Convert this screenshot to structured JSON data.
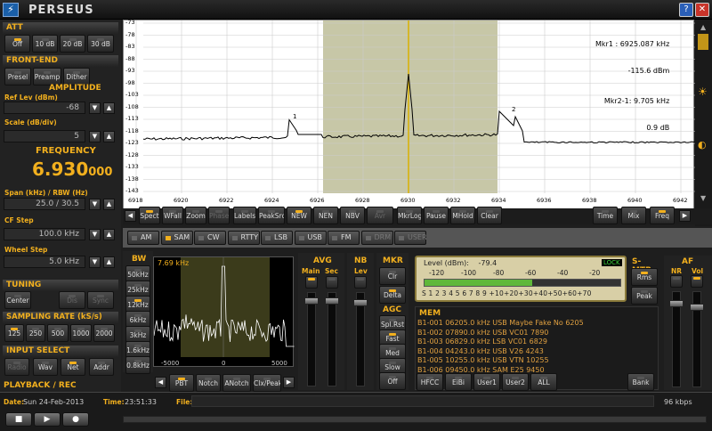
{
  "title": "PERSEUS",
  "att": {
    "title": "ATT",
    "buttons": [
      "Off",
      "10 dB",
      "20 dB",
      "30 dB"
    ]
  },
  "front_end": {
    "title": "FRONT-END",
    "buttons": [
      "Presel",
      "Preamp",
      "Dither"
    ]
  },
  "amplitude": {
    "title": "AMPLITUDE",
    "ref_label": "Ref Lev (dBm)",
    "ref_value": "-68",
    "scale_label": "Scale (dB/div)",
    "scale_value": "5"
  },
  "frequency": {
    "title": "FREQUENCY",
    "main": "6.930",
    "sub": "000",
    "span_label": "Span (kHz) / RBW (Hz)",
    "span_value": "25.0 / 30.5",
    "cf_label": "CF Step",
    "cf_value": "100.0 kHz",
    "wheel_label": "Wheel Step",
    "wheel_value": "5.0 kHz"
  },
  "tuning": {
    "title": "TUNING",
    "center": "Center",
    "tn2": "Dis",
    "tn3": "Sync"
  },
  "sampling": {
    "title": "SAMPLING RATE (kS/s)",
    "rates": [
      "125",
      "250",
      "500",
      "1000",
      "2000"
    ]
  },
  "input_select": {
    "title": "INPUT SELECT",
    "buttons": [
      "Radio",
      "Wav",
      "Net",
      "Addr"
    ]
  },
  "playback": {
    "title": "PLAYBACK / REC"
  },
  "status": {
    "date_label": "Date:",
    "date": "Sun 24-Feb-2013",
    "time_label": "Time:",
    "time": "23:51:33",
    "file_label": "File:",
    "rate": "96 kbps"
  },
  "spectrum": {
    "y_ticks": [
      "-73",
      "-78",
      "-83",
      "-88",
      "-93",
      "-98",
      "-103",
      "-108",
      "-113",
      "-118",
      "-123",
      "-128",
      "-133",
      "-138",
      "-143"
    ],
    "x_ticks": [
      "6918",
      "6920",
      "6922",
      "6924",
      "6926",
      "6928",
      "6930",
      "6932",
      "6934",
      "6936",
      "6938",
      "6940",
      "6942"
    ],
    "mkr1_label": "Mkr1 :",
    "mkr1_freq": "6925.087",
    "mkr1_funit": "kHz",
    "mkr1_level": "-115.6",
    "mkr1_lunit": "dBm",
    "mkr2_label": "Mkr2-1:",
    "mkr2_freq": "9.705",
    "mkr2_funit": "kHz",
    "mkr2_level": "0.9",
    "mkr2_lunit": "dB",
    "mark1": "1",
    "mark2": "2"
  },
  "spectrum_toolbar": {
    "left": [
      "Spect",
      "WFall",
      "Zoom",
      "Phase",
      "Labels",
      "PeakSrc",
      "NEW",
      "NEN",
      "NBV",
      "Avr",
      "MkrLog",
      "Pause",
      "MHold",
      "Clear"
    ],
    "right": [
      "Time",
      "Mix",
      "Freq"
    ]
  },
  "modes": [
    "AM",
    "SAM",
    "CW",
    "RTTY",
    "LSB",
    "USB",
    "FM",
    "DRM",
    "USER"
  ],
  "bw": {
    "title": "BW",
    "buttons": [
      "50kHz",
      "25kHz",
      "12kHz",
      "6kHz",
      "3kHz",
      "1.6kHz",
      "0.8kHz"
    ]
  },
  "if_spectrum": {
    "bw_label": "7.69 kHz",
    "x_ticks": [
      "-5000",
      "0",
      "5000"
    ]
  },
  "if_toolbar": [
    "PBT",
    "Notch",
    "ANotch",
    "Clx/Peak"
  ],
  "avg": {
    "title": "AVG",
    "main": "Main",
    "sec": "Sec"
  },
  "nb": {
    "title": "NB",
    "lev": "Lev"
  },
  "mkr": {
    "title": "MKR",
    "buttons": [
      "Clr",
      "Delta"
    ]
  },
  "agc": {
    "title": "AGC",
    "buttons": [
      "Spl.Rst",
      "Fast",
      "Med",
      "Slow",
      "Off"
    ]
  },
  "smeter": {
    "level_label": "Level (dBm):",
    "level_value": "-79.4",
    "lock": "LOCK",
    "top_scale": [
      "-120",
      "-100",
      "-80",
      "-60",
      "-40",
      "-20"
    ],
    "bottom_scale": "S 1 2 3 4 5 6 7 8 9 +10+20+30+40+50+60+70",
    "level_fraction": 0.55
  },
  "smtr": {
    "title": "S-MTR",
    "buttons": [
      "Rms",
      "Peak"
    ]
  },
  "af": {
    "title": "AF",
    "nr": "NR",
    "vol": "Vol"
  },
  "mem": {
    "title": "MEM",
    "rows": [
      "B1-001 06205.0 kHz USB  Maybe Fake No 6205",
      "B1-002 07890.0 kHz USB  VC01 7890",
      "B1-003 06829.0 kHz LSB  VC01 6829",
      "B1-004 04243.0 kHz USB  V26 4243",
      "B1-005 10255.0 kHz USB  VTN 10255",
      "B1-006 09450.0 kHz SAM  E25 9450"
    ],
    "buttons": [
      "HFCC",
      "EiBi",
      "User1",
      "User2",
      "ALL"
    ],
    "bank": "Bank"
  }
}
